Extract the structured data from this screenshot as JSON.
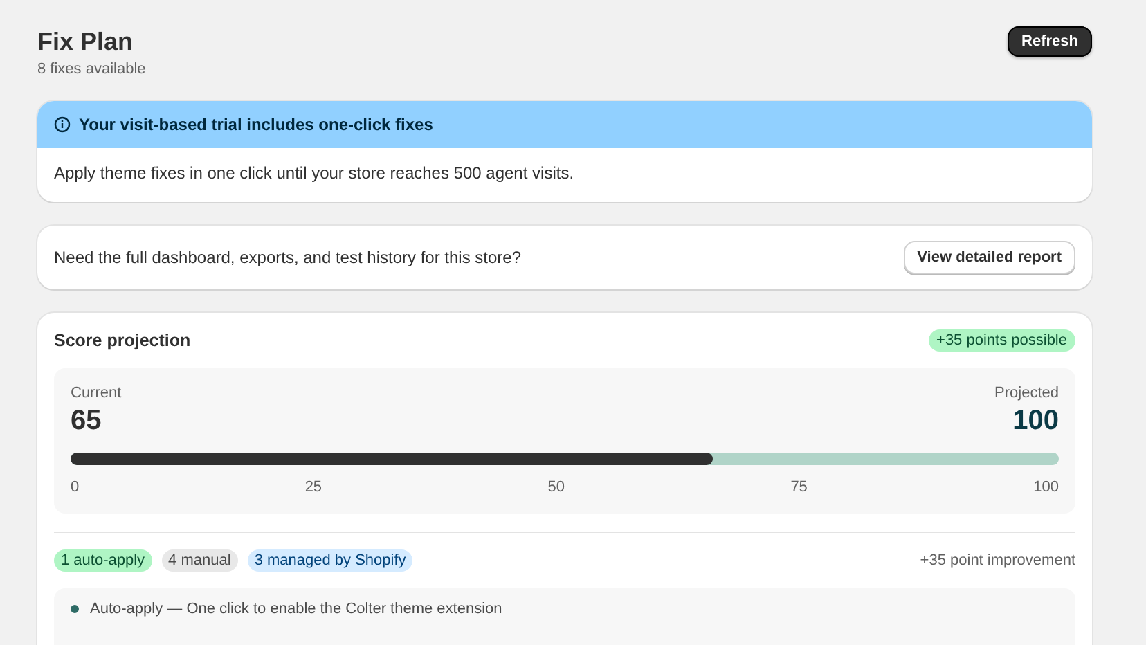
{
  "header": {
    "title": "Fix Plan",
    "subtitle": "8 fixes available",
    "refresh_button": "Refresh"
  },
  "trial_banner": {
    "title": "Your visit-based trial includes one-click fixes",
    "body": "Apply theme fixes in one click until your store reaches 500 agent visits."
  },
  "report_card": {
    "text": "Need the full dashboard, exports, and test history for this store?",
    "button": "View detailed report"
  },
  "score_projection": {
    "title": "Score projection",
    "badge": "+35 points possible",
    "current_label": "Current",
    "current_value": "65",
    "projected_label": "Projected",
    "projected_value": "100",
    "level": 0.65,
    "scale": [
      "0",
      "25",
      "50",
      "75",
      "100"
    ],
    "tags": [
      {
        "label": "1 auto-apply",
        "kind": "auto"
      },
      {
        "label": "4 manual",
        "kind": "manual"
      },
      {
        "label": "3 managed by Shopify",
        "kind": "managed"
      }
    ],
    "improvement": "+35 point improvement",
    "fixes": [
      {
        "text": "Auto-apply — One click to enable the Colter theme extension",
        "color": "#2e6b66"
      }
    ]
  }
}
